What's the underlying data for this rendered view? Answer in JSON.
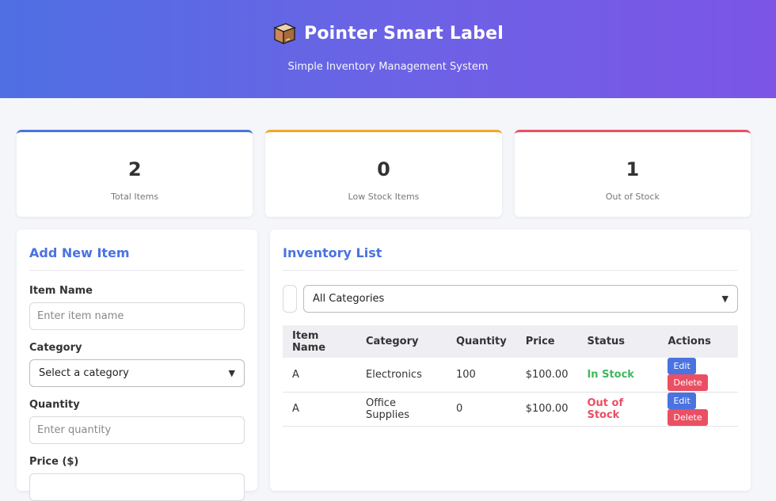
{
  "header": {
    "title": "Pointer Smart Label",
    "subtitle": "Simple Inventory Management System"
  },
  "stats": [
    {
      "value": "2",
      "label": "Total Items"
    },
    {
      "value": "0",
      "label": "Low Stock Items"
    },
    {
      "value": "1",
      "label": "Out of Stock"
    }
  ],
  "add_form": {
    "title": "Add New Item",
    "item_name_label": "Item Name",
    "item_name_placeholder": "Enter item name",
    "category_label": "Category",
    "category_selected": "Select a category",
    "quantity_label": "Quantity",
    "quantity_placeholder": "Enter quantity",
    "price_label": "Price ($)"
  },
  "inventory": {
    "title": "Inventory List",
    "category_filter": "All Categories",
    "columns": [
      "Item Name",
      "Category",
      "Quantity",
      "Price",
      "Status",
      "Actions"
    ],
    "rows": [
      {
        "name": "A",
        "category": "Electronics",
        "quantity": "100",
        "price": "$100.00",
        "status": "In Stock"
      },
      {
        "name": "A",
        "category": "Office Supplies",
        "quantity": "0",
        "price": "$100.00",
        "status": "Out of Stock"
      }
    ],
    "edit_label": "Edit",
    "delete_label": "Delete"
  },
  "colors": {
    "accent": "#4a73e0",
    "warning": "#f5a623",
    "danger": "#ea4f63",
    "success": "#3fb85e"
  }
}
